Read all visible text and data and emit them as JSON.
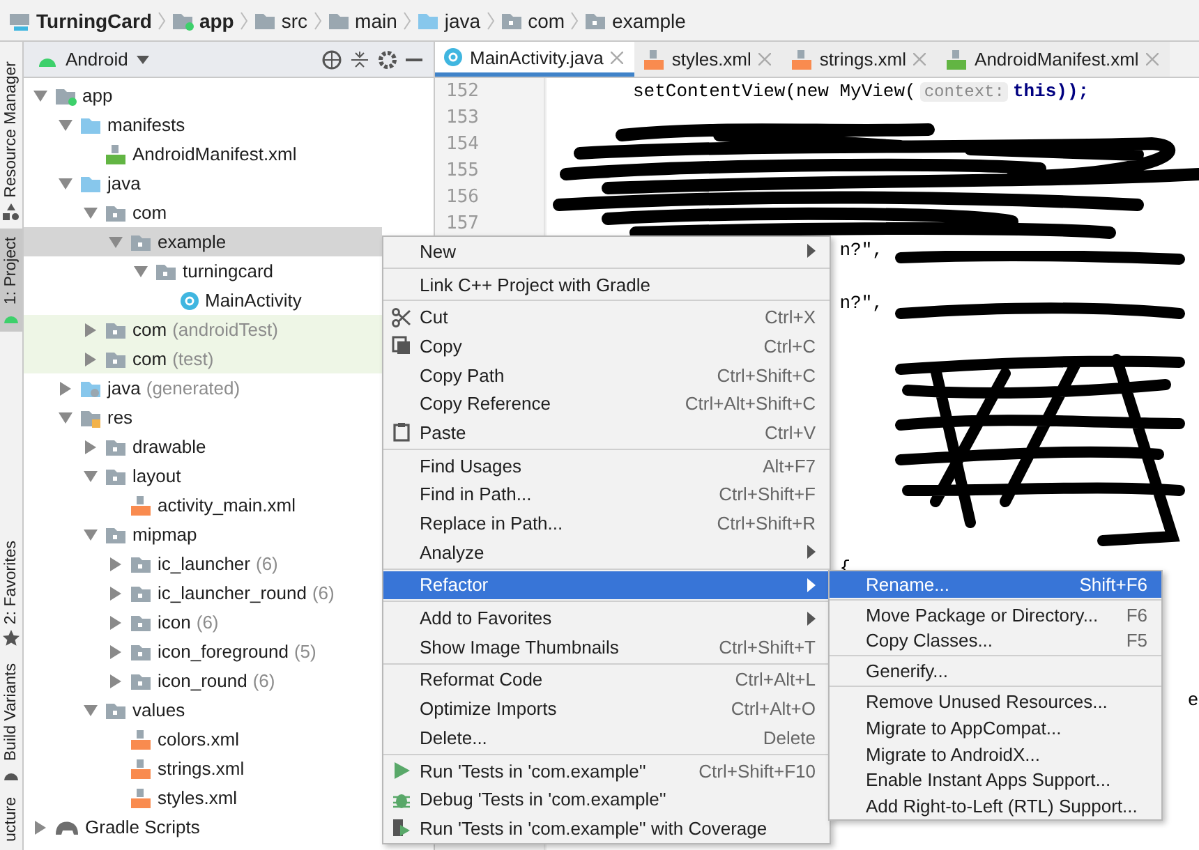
{
  "breadcrumb": [
    {
      "label": "TurningCard",
      "kind": "project"
    },
    {
      "label": "app",
      "kind": "module"
    },
    {
      "label": "src",
      "kind": "folder"
    },
    {
      "label": "main",
      "kind": "folder"
    },
    {
      "label": "java",
      "kind": "source"
    },
    {
      "label": "com",
      "kind": "package"
    },
    {
      "label": "example",
      "kind": "package"
    }
  ],
  "side_tabs": [
    {
      "label": "Resource Manager",
      "selected": false,
      "kind": "resources"
    },
    {
      "label": "1: Project",
      "selected": true,
      "kind": "project"
    },
    {
      "label": "2: Favorites",
      "selected": false,
      "kind": "favorites"
    },
    {
      "label": "Build Variants",
      "selected": false,
      "kind": "variants"
    },
    {
      "label": "ucture",
      "selected": false,
      "kind": "none"
    }
  ],
  "project": {
    "view": "Android",
    "tree": [
      {
        "label": "app",
        "kind": "module",
        "expanded": true,
        "selected": false,
        "test": false,
        "children": [
          {
            "label": "manifests",
            "kind": "source",
            "expanded": true,
            "selected": false,
            "test": false,
            "children": [
              {
                "label": "AndroidManifest.xml",
                "kind": "manifest",
                "selected": false,
                "test": false
              }
            ]
          },
          {
            "label": "java",
            "kind": "source",
            "expanded": true,
            "selected": false,
            "test": false,
            "children": [
              {
                "label": "com",
                "kind": "package",
                "expanded": true,
                "selected": false,
                "test": false,
                "children": [
                  {
                    "label": "example",
                    "kind": "package",
                    "expanded": true,
                    "selected": true,
                    "test": false,
                    "children": [
                      {
                        "label": "turningcard",
                        "kind": "package",
                        "expanded": true,
                        "selected": false,
                        "test": false,
                        "children": [
                          {
                            "label": "MainActivity",
                            "kind": "class",
                            "selected": false,
                            "test": false
                          }
                        ]
                      }
                    ]
                  }
                ]
              },
              {
                "label": "com",
                "hint": "(androidTest)",
                "kind": "package",
                "expanded": false,
                "selected": false,
                "test": true
              },
              {
                "label": "com",
                "hint": "(test)",
                "kind": "package",
                "expanded": false,
                "selected": false,
                "test": true
              }
            ]
          },
          {
            "label": "java",
            "hint": "(generated)",
            "kind": "generated",
            "expanded": false,
            "selected": false,
            "test": false
          },
          {
            "label": "res",
            "kind": "res",
            "expanded": true,
            "selected": false,
            "test": false,
            "children": [
              {
                "label": "drawable",
                "kind": "package",
                "expanded": false,
                "selected": false,
                "test": false
              },
              {
                "label": "layout",
                "kind": "package",
                "expanded": true,
                "selected": false,
                "test": false,
                "children": [
                  {
                    "label": "activity_main.xml",
                    "kind": "xml",
                    "selected": false,
                    "test": false
                  }
                ]
              },
              {
                "label": "mipmap",
                "kind": "package",
                "expanded": true,
                "selected": false,
                "test": false,
                "children": [
                  {
                    "label": "ic_launcher",
                    "hint": "(6)",
                    "kind": "package",
                    "expanded": false,
                    "selected": false,
                    "test": false
                  },
                  {
                    "label": "ic_launcher_round",
                    "hint": "(6)",
                    "kind": "package",
                    "expanded": false,
                    "selected": false,
                    "test": false
                  },
                  {
                    "label": "icon",
                    "hint": "(6)",
                    "kind": "package",
                    "expanded": false,
                    "selected": false,
                    "test": false
                  },
                  {
                    "label": "icon_foreground",
                    "hint": "(5)",
                    "kind": "package",
                    "expanded": false,
                    "selected": false,
                    "test": false
                  },
                  {
                    "label": "icon_round",
                    "hint": "(6)",
                    "kind": "package",
                    "expanded": false,
                    "selected": false,
                    "test": false
                  }
                ]
              },
              {
                "label": "values",
                "kind": "package",
                "expanded": true,
                "selected": false,
                "test": false,
                "children": [
                  {
                    "label": "colors.xml",
                    "kind": "xml",
                    "selected": false,
                    "test": false
                  },
                  {
                    "label": "strings.xml",
                    "kind": "xml",
                    "selected": false,
                    "test": false
                  },
                  {
                    "label": "styles.xml",
                    "kind": "xml",
                    "selected": false,
                    "test": false
                  }
                ]
              }
            ]
          }
        ]
      },
      {
        "label": "Gradle Scripts",
        "kind": "gradle",
        "expanded": false,
        "selected": false,
        "test": false
      }
    ]
  },
  "tabs": [
    {
      "label": "MainActivity.java",
      "kind": "class",
      "selected": true
    },
    {
      "label": "styles.xml",
      "kind": "xml",
      "selected": false
    },
    {
      "label": "strings.xml",
      "kind": "xml",
      "selected": false
    },
    {
      "label": "AndroidManifest.xml",
      "kind": "manifest",
      "selected": false
    }
  ],
  "editor": {
    "line_numbers": [
      "152",
      "153",
      "154",
      "155",
      "156",
      "157"
    ],
    "lines": [
      "setContentView(new MyView("
    ],
    "fragments": [
      "n?\",",
      "n?\",",
      "{",
      "e"
    ],
    "inlay": "context:",
    "line_tail": "this));"
  },
  "context_menu": [
    [
      {
        "label": "New",
        "kind": "submenu",
        "selected": false
      }
    ],
    [
      {
        "label": "Link C++ Project with Gradle",
        "kind": "action",
        "selected": false
      }
    ],
    [
      {
        "label": "Cut",
        "shortcut": "Ctrl+X",
        "kind": "action",
        "selected": false
      },
      {
        "label": "Copy",
        "shortcut": "Ctrl+C",
        "kind": "action",
        "selected": false
      },
      {
        "label": "Copy Path",
        "shortcut": "Ctrl+Shift+C",
        "kind": "action",
        "selected": false
      },
      {
        "label": "Copy Reference",
        "shortcut": "Ctrl+Alt+Shift+C",
        "kind": "action",
        "selected": false
      },
      {
        "label": "Paste",
        "shortcut": "Ctrl+V",
        "kind": "action",
        "selected": false
      }
    ],
    [
      {
        "label": "Find Usages",
        "shortcut": "Alt+F7",
        "kind": "action",
        "selected": false
      },
      {
        "label": "Find in Path...",
        "shortcut": "Ctrl+Shift+F",
        "kind": "action",
        "selected": false
      },
      {
        "label": "Replace in Path...",
        "shortcut": "Ctrl+Shift+R",
        "kind": "action",
        "selected": false
      },
      {
        "label": "Analyze",
        "kind": "submenu",
        "selected": false
      }
    ],
    [
      {
        "label": "Refactor",
        "kind": "submenu",
        "selected": true
      }
    ],
    [
      {
        "label": "Add to Favorites",
        "kind": "submenu",
        "selected": false
      },
      {
        "label": "Show Image Thumbnails",
        "shortcut": "Ctrl+Shift+T",
        "kind": "action",
        "selected": false
      }
    ],
    [
      {
        "label": "Reformat Code",
        "shortcut": "Ctrl+Alt+L",
        "kind": "action",
        "selected": false
      },
      {
        "label": "Optimize Imports",
        "shortcut": "Ctrl+Alt+O",
        "kind": "action",
        "selected": false
      },
      {
        "label": "Delete...",
        "shortcut": "Delete",
        "kind": "action",
        "selected": false
      }
    ],
    [
      {
        "label": "Run 'Tests in 'com.example''",
        "shortcut": "Ctrl+Shift+F10",
        "kind": "action",
        "selected": false
      },
      {
        "label": "Debug 'Tests in 'com.example''",
        "kind": "action",
        "selected": false
      },
      {
        "label": "Run 'Tests in 'com.example'' with Coverage",
        "kind": "action",
        "selected": false
      }
    ]
  ],
  "refactor_menu": [
    [
      {
        "label": "Rename...",
        "shortcut": "Shift+F6",
        "kind": "action",
        "selected": true
      }
    ],
    [
      {
        "label": "Move Package or Directory...",
        "shortcut": "F6",
        "kind": "action",
        "selected": false
      },
      {
        "label": "Copy Classes...",
        "shortcut": "F5",
        "kind": "action",
        "selected": false
      }
    ],
    [
      {
        "label": "Generify...",
        "kind": "action",
        "selected": false
      }
    ],
    [
      {
        "label": "Remove Unused Resources...",
        "kind": "action",
        "selected": false
      },
      {
        "label": "Migrate to AppCompat...",
        "kind": "action",
        "selected": false
      },
      {
        "label": "Migrate to AndroidX...",
        "kind": "action",
        "selected": false
      },
      {
        "label": "Enable Instant Apps Support...",
        "kind": "action",
        "selected": false
      },
      {
        "label": "Add Right-to-Left (RTL) Support...",
        "kind": "action",
        "selected": false
      }
    ]
  ]
}
